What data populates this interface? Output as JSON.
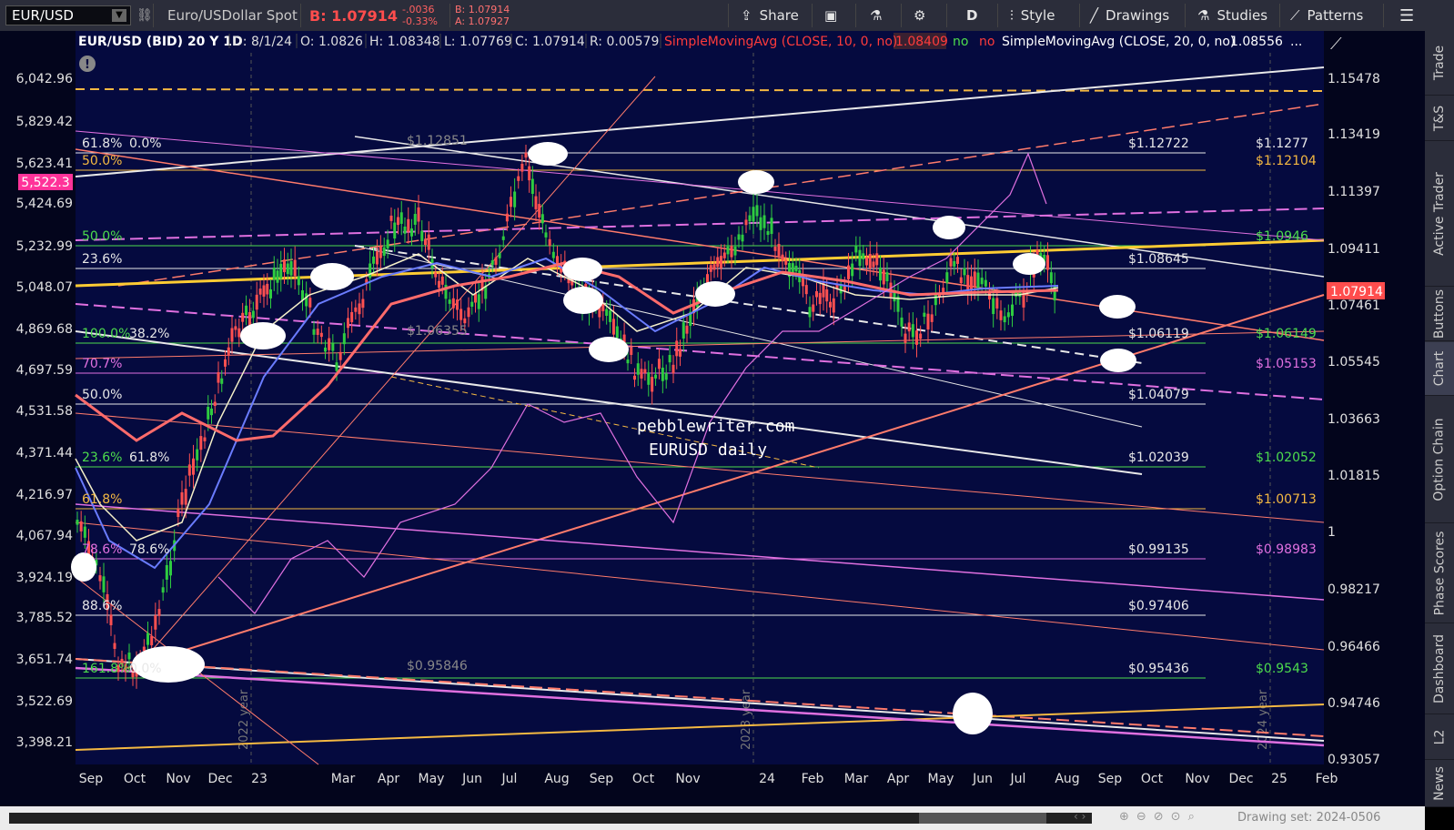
{
  "toolbar": {
    "symbol": "EUR/USD",
    "description": "Euro/USDollar Spot",
    "bid_label": "B: 1.07914",
    "change": "-.0036",
    "change_pct": "-0.33%",
    "bid_small": "B: 1.07914",
    "ask_small": "A: 1.07927",
    "share": "Share",
    "period": "D",
    "style": "Style",
    "drawings": "Drawings",
    "studies": "Studies",
    "patterns": "Patterns"
  },
  "infobar": {
    "title": "EUR/USD (BID) 20 Y 1D",
    "date": "D: 8/1/24",
    "open": "O: 1.0826",
    "open_sub": "",
    "high": "H: 1.0834",
    "high_sub": "8",
    "low": "L: 1.0776",
    "low_sub": "9",
    "close": "C: 1.0791",
    "close_sub": "4",
    "range": "R: 0.0057",
    "range_sub": "9",
    "sma10": "SimpleMovingAvg (CLOSE, 10, 0, no)",
    "sma10_val": "1.0840",
    "sma10_sub": "9",
    "no1": "no",
    "no2": "no",
    "sma20": "SimpleMovingAvg (CLOSE, 20, 0, no)",
    "sma20_val": "1.0855",
    "sma20_sub": "6",
    "ellipsis": "..."
  },
  "right_tabs": [
    "Trade",
    "T&S",
    "Active Trader",
    "Buttons",
    "Chart",
    "Option Chain",
    "Phase Scores",
    "Dashboard",
    "L2",
    "News"
  ],
  "bottom": {
    "drawing_set": "Drawing set: 2024-0506"
  },
  "colors": {
    "bg": "#050a3f",
    "panel": "#2b2d3a",
    "up": "#2ecc40",
    "down": "#ff5050",
    "orange": "#ff7b6b",
    "gold": "#f5b942",
    "magenta": "#e070e0",
    "green": "#4ddc4d"
  },
  "chart_data": {
    "type": "candlestick",
    "watermark": [
      "pebblewriter.com",
      "EURUSD daily"
    ],
    "right_axis": [
      "1.15478",
      "1.13419",
      "1.11397",
      "1.09411",
      "1.07461",
      "1.05545",
      "1.03663",
      "1.01815",
      "1",
      "0.98217",
      "0.96466",
      "0.94746",
      "0.93057"
    ],
    "left_axis": [
      "6,042.96",
      "5,829.42",
      "5,623.41",
      "5,424.69",
      "5,232.99",
      "5,048.07",
      "4,869.68",
      "4,697.59",
      "4,531.58",
      "4,371.44",
      "4,216.97",
      "4,067.94",
      "3,924.19",
      "3,785.52",
      "3,651.74",
      "3,522.69",
      "3,398.21"
    ],
    "left_badge": "5,522.3",
    "last_price": "1.07914",
    "x_ticks": [
      "Sep",
      "Oct",
      "Nov",
      "Dec",
      "23",
      "Mar",
      "Apr",
      "May",
      "Jun",
      "Jul",
      "Aug",
      "Sep",
      "Oct",
      "Nov",
      "24",
      "Feb",
      "Mar",
      "Apr",
      "May",
      "Jun",
      "Jul",
      "Aug",
      "Sep",
      "Oct",
      "Nov",
      "Dec",
      "25",
      "Feb"
    ],
    "year_marks": [
      "2022 year",
      "2023 year",
      "2024 year"
    ],
    "fib_levels": [
      {
        "pct": "61.8%",
        "pct2": "0.0%",
        "mid": "$1.1285",
        "mid_sub": "1",
        "price": "$1.1272",
        "sub": "2",
        "right": "$1.1277",
        "color": "#e8e8e8"
      },
      {
        "pct": "50.0%",
        "price": "",
        "right": "$1.1210",
        "sub2": "4",
        "color": "#f5b942"
      },
      {
        "pct": "50.0%",
        "right": "$1.0946",
        "color": "#4ddc4d"
      },
      {
        "pct": "23.6%",
        "price": "$1.0864",
        "sub": "5",
        "color": "#e8e8e8"
      },
      {
        "pct": "100.0%",
        "pct2": "38.2%",
        "pct3": "38.2%",
        "mid": "$1.0635",
        "mid_sub": "5",
        "price": "$1.0611",
        "sub": "9",
        "right": "$1.0614",
        "sub2": "9",
        "color": "#4ddc4d"
      },
      {
        "pct": "70.7%",
        "right": "$1.0515",
        "sub2": "3",
        "color": "#e070e0"
      },
      {
        "pct": "50.0%",
        "price": "$1.0407",
        "sub": "9",
        "color": "#e8e8e8"
      },
      {
        "pct": "23.6%",
        "pct2": "61.8%",
        "price": "$1.0203",
        "sub": "9",
        "right": "$1.0205",
        "sub2": "2",
        "color": "#4ddc4d"
      },
      {
        "pct": "61.8%",
        "right": "$1.0071",
        "sub2": "3",
        "color": "#f5b942"
      },
      {
        "pct": "78.6%",
        "pct2": "78.6%",
        "price": "$0.9913",
        "sub": "5",
        "right": "$0.9898",
        "sub2": "3",
        "color": "#e070e0"
      },
      {
        "pct": "88.6%",
        "price": "$0.9740",
        "sub": "6",
        "color": "#e8e8e8"
      },
      {
        "pct": "161.8%",
        "pct2": "0.0%",
        "mid": "$0.9584",
        "mid_sub": "6",
        "price": "$0.9543",
        "sub": "6",
        "right": "$0.9543",
        "color": "#4ddc4d"
      }
    ],
    "y_range": [
      0.93057,
      1.15478
    ],
    "legend": "none"
  }
}
